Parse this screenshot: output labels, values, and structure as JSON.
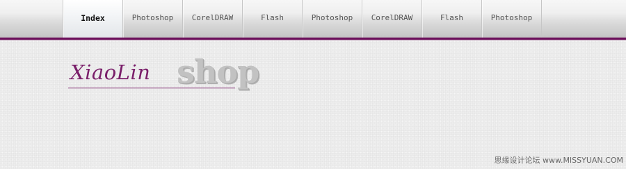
{
  "nav": {
    "items": [
      {
        "label": "Index",
        "active": true
      },
      {
        "label": "Photoshop",
        "active": false
      },
      {
        "label": "CorelDRAW",
        "active": false
      },
      {
        "label": "Flash",
        "active": false
      },
      {
        "label": "Photoshop",
        "active": false
      },
      {
        "label": "CorelDRAW",
        "active": false
      },
      {
        "label": "Flash",
        "active": false
      },
      {
        "label": "Photoshop",
        "active": false
      }
    ]
  },
  "logo": {
    "script_text": "XiaoLin",
    "shop_text": "shop"
  },
  "watermark": {
    "text": "思缘设计论坛 www.MISSYUAN.COM"
  },
  "colors": {
    "accent_purple": "#6b0f5a",
    "logo_purple": "#7a1f6a",
    "page_background": "#ededed"
  }
}
